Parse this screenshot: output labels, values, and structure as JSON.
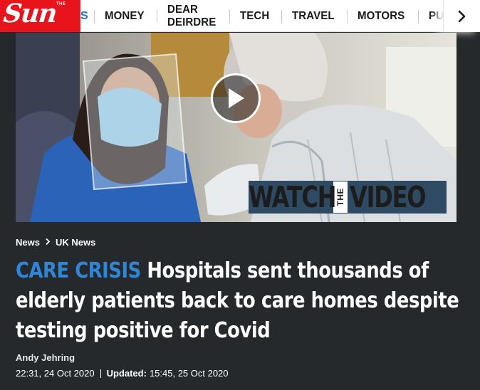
{
  "brand": {
    "logo_word": "Sun",
    "logo_the": "THE",
    "clipped_prev_item": "S"
  },
  "nav": {
    "items": [
      {
        "label": "MONEY"
      },
      {
        "label": "DEAR DEIRDRE"
      },
      {
        "label": "TECH"
      },
      {
        "label": "TRAVEL"
      },
      {
        "label": "MOTORS"
      },
      {
        "label": "PUZZLES"
      }
    ],
    "next_icon": "chevron-right-icon"
  },
  "media": {
    "play_icon": "play-icon",
    "watch_left": "WATCH",
    "watch_the": "THE",
    "watch_right": "VIDEO"
  },
  "breadcrumb": {
    "first": "News",
    "second": "UK News",
    "separator_icon": "chevron-right-icon"
  },
  "article": {
    "kicker": "CARE CRISIS",
    "headline_line1": "Hospitals sent thousands of",
    "headline_line2": "elderly patients back to care homes despite",
    "headline_line3": "testing positive for Covid",
    "author": "Andy Jehring",
    "published": "22:31, 24 Oct 2020",
    "updated_label": "Updated:",
    "updated": "15:45, 25 Oct 2020"
  },
  "colors": {
    "brand_red": "#e8141c",
    "kicker_blue": "#2f86d6",
    "page_bg": "#25292c"
  }
}
